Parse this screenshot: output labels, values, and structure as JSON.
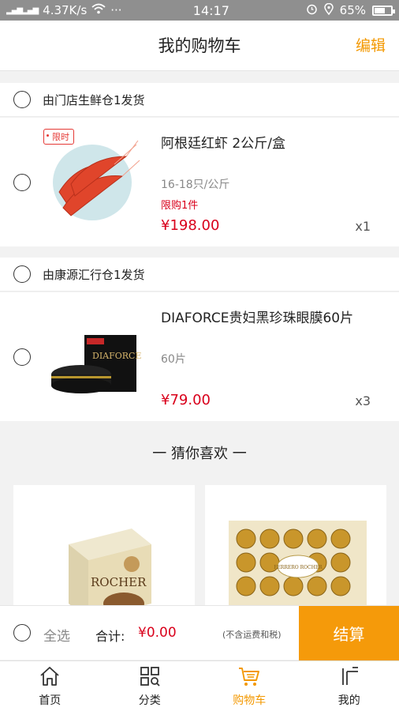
{
  "status_bar": {
    "network": "4G 2G",
    "speed": "4.37K/s",
    "more": "···",
    "time": "14:17",
    "battery": "65%",
    "battery_level": 0.65
  },
  "header": {
    "title": "我的购物车",
    "edit_label": "编辑"
  },
  "stores": [
    {
      "label": "由门店生鲜仓1发货",
      "item": {
        "tag": "限时",
        "name": "阿根廷红虾 2公斤/盒",
        "spec": "16-18只/公斤",
        "limit": "限购1件",
        "price": "¥198.00",
        "qty": "x1"
      }
    },
    {
      "label": "由康源汇行仓1发货",
      "item": {
        "name": "DIAFORCE贵妇黑珍珠眼膜60片",
        "spec": "60片",
        "price": "¥79.00",
        "qty": "x3",
        "brand_text": "DIAFORCE"
      }
    }
  ],
  "recommend": {
    "title": "一 猜你喜欢 一",
    "items": [
      {
        "brand": "ROCHER"
      },
      {
        "brand": "FERRERO ROCHER"
      }
    ]
  },
  "checkout": {
    "select_all": "全选",
    "total_label": "合计:",
    "total_value": "¥0.00",
    "tax_note": "(不含运费和税)",
    "button": "结算"
  },
  "tabs": [
    {
      "label": "首页",
      "icon": "home-icon"
    },
    {
      "label": "分类",
      "icon": "category-icon"
    },
    {
      "label": "购物车",
      "icon": "cart-icon",
      "active": true
    },
    {
      "label": "我的",
      "icon": "profile-icon"
    }
  ],
  "colors": {
    "accent": "#f39800",
    "price": "#d9001b",
    "status_bar": "#8f8f8f"
  }
}
